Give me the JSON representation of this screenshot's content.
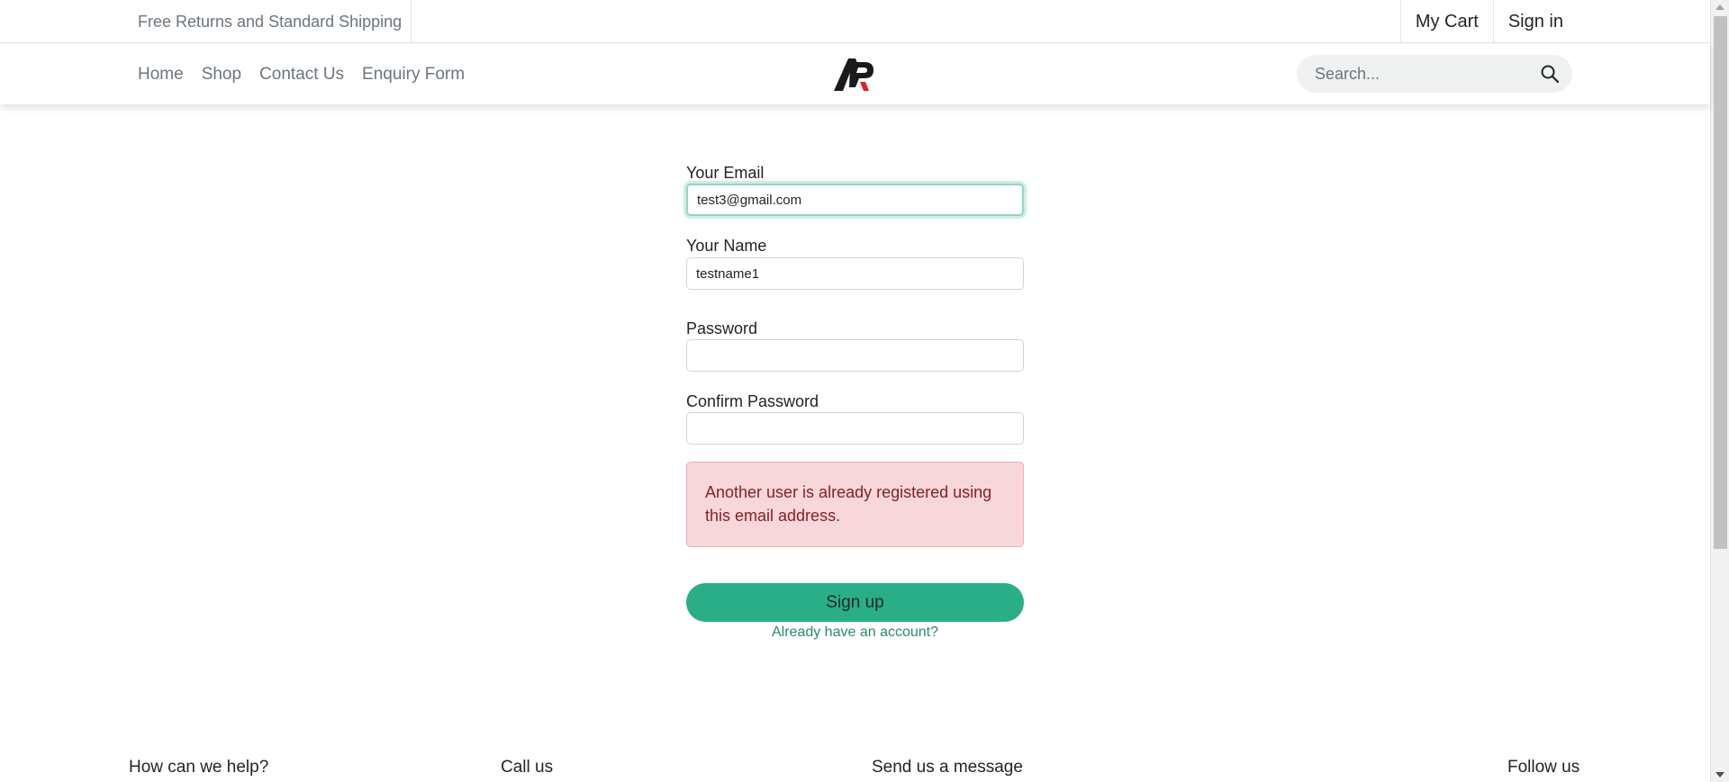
{
  "topbar": {
    "promo": "Free Returns and Standard Shipping",
    "cart_label": "My Cart",
    "signin_label": "Sign in"
  },
  "nav": {
    "items": [
      {
        "label": "Home"
      },
      {
        "label": "Shop"
      },
      {
        "label": "Contact Us"
      },
      {
        "label": "Enquiry Form"
      }
    ],
    "logo_icon": "ap-logo-icon",
    "search_placeholder": "Search...",
    "search_icon": "search-icon"
  },
  "form": {
    "email_label": "Your Email",
    "email_value": "test3@gmail.com",
    "name_label": "Your Name",
    "name_value": "testname1",
    "password_label": "Password",
    "password_value": "",
    "confirm_label": "Confirm Password",
    "confirm_value": "",
    "error_message": "Another user is already registered using this email address.",
    "submit_label": "Sign up",
    "login_link": "Already have an account?"
  },
  "footer": {
    "headings": [
      "How can we help?",
      "Call us",
      "Send us a message",
      "Follow us"
    ]
  },
  "colors": {
    "accent": "#2aae87",
    "alert_bg": "#f8d7da",
    "alert_text": "#842029",
    "link": "#2a8a6a"
  }
}
